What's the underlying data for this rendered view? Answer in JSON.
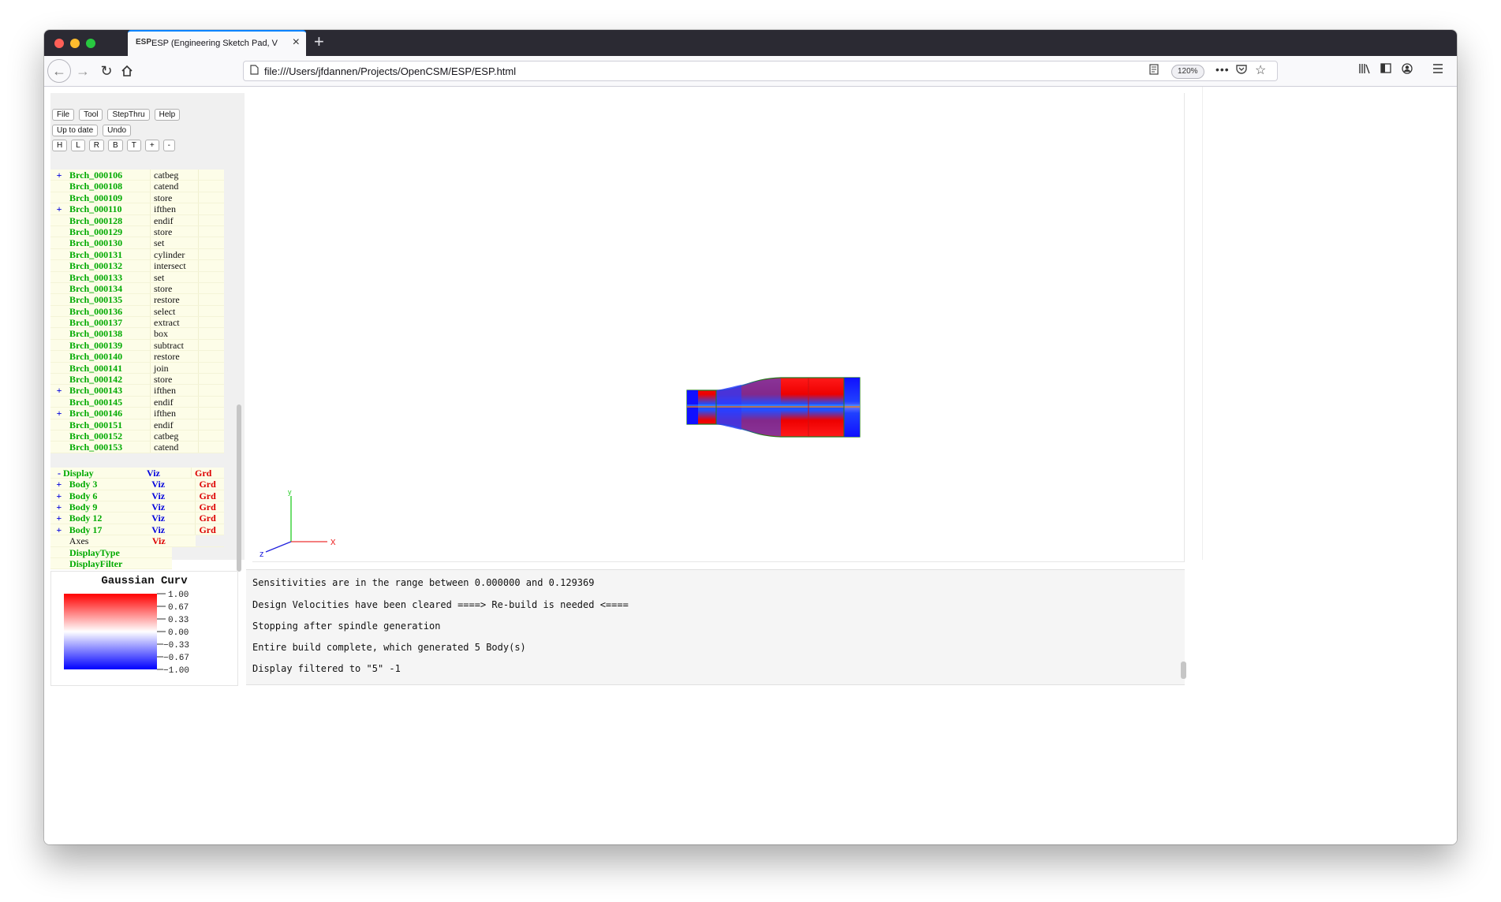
{
  "browser": {
    "tab_title": "ESP (Engineering Sketch Pad, V",
    "tab_favicon": "ESP",
    "url": "file:///Users/jfdannen/Projects/OpenCSM/ESP/ESP.html",
    "zoom": "120%"
  },
  "toolbar": {
    "row1": [
      "File",
      "Tool",
      "StepThru",
      "Help"
    ],
    "row2": [
      "Up to date",
      "Undo"
    ],
    "row3": [
      "H",
      "L",
      "R",
      "B",
      "T",
      "+",
      "-"
    ]
  },
  "branches": [
    {
      "pm": "+",
      "name": "Brch_000106",
      "type": "catbeg"
    },
    {
      "pm": "",
      "name": "Brch_000108",
      "type": "catend"
    },
    {
      "pm": "",
      "name": "Brch_000109",
      "type": "store"
    },
    {
      "pm": "+",
      "name": "Brch_000110",
      "type": "ifthen"
    },
    {
      "pm": "",
      "name": "Brch_000128",
      "type": "endif"
    },
    {
      "pm": "",
      "name": "Brch_000129",
      "type": "store"
    },
    {
      "pm": "",
      "name": "Brch_000130",
      "type": "set"
    },
    {
      "pm": "",
      "name": "Brch_000131",
      "type": "cylinder"
    },
    {
      "pm": "",
      "name": "Brch_000132",
      "type": "intersect"
    },
    {
      "pm": "",
      "name": "Brch_000133",
      "type": "set"
    },
    {
      "pm": "",
      "name": "Brch_000134",
      "type": "store"
    },
    {
      "pm": "",
      "name": "Brch_000135",
      "type": "restore"
    },
    {
      "pm": "",
      "name": "Brch_000136",
      "type": "select"
    },
    {
      "pm": "",
      "name": "Brch_000137",
      "type": "extract"
    },
    {
      "pm": "",
      "name": "Brch_000138",
      "type": "box"
    },
    {
      "pm": "",
      "name": "Brch_000139",
      "type": "subtract"
    },
    {
      "pm": "",
      "name": "Brch_000140",
      "type": "restore"
    },
    {
      "pm": "",
      "name": "Brch_000141",
      "type": "join"
    },
    {
      "pm": "",
      "name": "Brch_000142",
      "type": "store"
    },
    {
      "pm": "+",
      "name": "Brch_000143",
      "type": "ifthen"
    },
    {
      "pm": "",
      "name": "Brch_000145",
      "type": "endif"
    },
    {
      "pm": "+",
      "name": "Brch_000146",
      "type": "ifthen"
    },
    {
      "pm": "",
      "name": "Brch_000151",
      "type": "endif"
    },
    {
      "pm": "",
      "name": "Brch_000152",
      "type": "catbeg"
    },
    {
      "pm": "",
      "name": "Brch_000153",
      "type": "catend"
    }
  ],
  "display": {
    "header": {
      "pm": "-",
      "name": "Display",
      "viz": "Viz",
      "grd": "Grd"
    },
    "bodies": [
      {
        "pm": "+",
        "name": "Body 3",
        "viz": "Viz",
        "grd": "Grd"
      },
      {
        "pm": "+",
        "name": "Body 6",
        "viz": "Viz",
        "grd": "Grd"
      },
      {
        "pm": "+",
        "name": "Body 9",
        "viz": "Viz",
        "grd": "Grd"
      },
      {
        "pm": "+",
        "name": "Body 12",
        "viz": "Viz",
        "grd": "Grd"
      },
      {
        "pm": "+",
        "name": "Body 17",
        "viz": "Viz",
        "grd": "Grd"
      }
    ],
    "axes": {
      "name": "Axes",
      "viz": "Viz"
    },
    "display_type": "DisplayType",
    "display_filter": "DisplayFilter"
  },
  "axes_labels": {
    "x": "x",
    "y": "y",
    "z": "z"
  },
  "legend": {
    "title": "Gaussian Curv",
    "ticks": [
      "1.00",
      "0.67",
      "0.33",
      "0.00",
      "−0.33",
      "−0.67",
      "−1.00"
    ],
    "colors": {
      "top": "#ff0000",
      "middle": "#ffffff",
      "bottom": "#0000ff"
    }
  },
  "messages": [
    "Sensitivities are in the range between 0.000000 and 0.129369",
    "Design Velocities have been cleared ====> Re-build is needed <====",
    "Stopping after spindle generation",
    "Entire build complete, which generated 5 Body(s)",
    "Display filtered to \"5\" -1"
  ]
}
